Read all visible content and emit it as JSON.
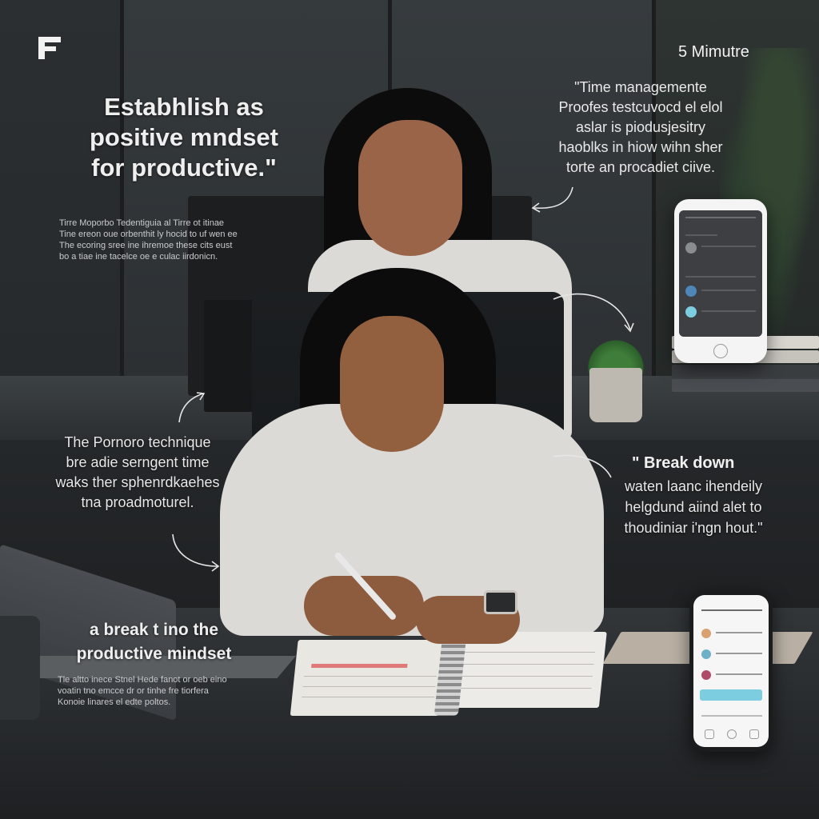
{
  "logo": {
    "icon": "f-logo-icon",
    "color": "#f2f2f2"
  },
  "timer": {
    "label": "5 Mimutre"
  },
  "headline_main": {
    "lines": [
      "Estabhlish as",
      "positive mndset",
      "for productive.\""
    ]
  },
  "quote_top": {
    "lines": [
      "\"Time managemente",
      "Proofes testcuvocd el elol",
      "aslar is piodusjesitry",
      "haoblks in hiow wihn sher",
      "torte an procadiet ciive."
    ]
  },
  "small_left": {
    "lines": [
      "Tirre Moporbo Tedentiguia al Tirre ot itinae",
      "Tine ereon oue orbenthit ly hocid to uf wen ee",
      "The ecoring sree ine ihremoe these cits eust",
      "bo a tiae ine tacelce oe e culac iirdonicn."
    ]
  },
  "pomodoro": {
    "lines": [
      "The Pornoro technique",
      "bre adie serngent time",
      "waks ther sphenrdkaehes",
      "tna proadmoturel."
    ]
  },
  "break_title": "\" Break down",
  "break_body": {
    "lines": [
      "waten laanc ihendeily",
      "helgdund aiind alet to",
      "thoudiniar i'ngn hout.\""
    ]
  },
  "bottom_headline": {
    "lines": [
      "a break t ino the",
      "productive mindset"
    ]
  },
  "small_bottom": {
    "lines": [
      "Tle altto inece Stnel Hede fanot or oeb eino",
      "voatin tno emcce dr or tinhe fre tiorfera",
      "Konoie linares el edte poltos."
    ]
  },
  "colors": {
    "text": "#efefef",
    "phone_accent": "#7ccde0",
    "notebook_highlight": "#e07a78"
  },
  "icons": [
    "f-logo-icon",
    "curved-arrow-icon",
    "home-button-icon"
  ]
}
